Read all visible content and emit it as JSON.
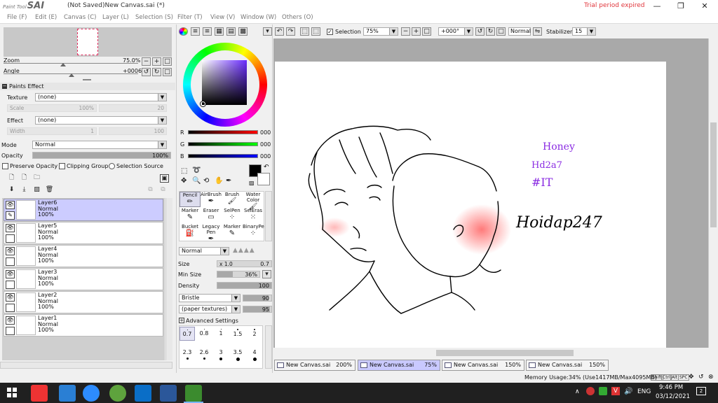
{
  "titlebar": {
    "logo_small": "Paint Tool",
    "logo_big": "SAI",
    "title": "(Not Saved)New Canvas.sai (*)",
    "trial_text": "Trial period expired",
    "min_glyph": "—",
    "max_glyph": "❐",
    "close_glyph": "✕"
  },
  "menu": [
    "File (F)",
    "Edit (E)",
    "Canvas (C)",
    "Layer (L)",
    "Selection (S)",
    "Filter (T)",
    "View (V)",
    "Window (W)",
    "Others (O)"
  ],
  "nav": {
    "zoom_label": "Zoom",
    "zoom_value": "75.0%",
    "angle_label": "Angle",
    "angle_value": "+0006"
  },
  "paints_effect": {
    "header": "Paints Effect",
    "texture_label": "Texture",
    "texture_value": "(none)",
    "scale_label": "Scale",
    "scale_value": "100%",
    "scale_right": "20",
    "effect_label": "Effect",
    "effect_value": "(none)",
    "width_label": "Width",
    "width_value": "1",
    "width_right": "100"
  },
  "layer_props": {
    "mode_label": "Mode",
    "mode_value": "Normal",
    "opacity_label": "Opacity",
    "opacity_value": "100%",
    "opacity_fraction": 1.0,
    "preserve_opacity": "Preserve Opacity",
    "clipping_group": "Clipping Group",
    "selection_source": "Selection Source"
  },
  "layers": [
    {
      "name": "Layer6",
      "mode": "Normal",
      "opacity": "100%",
      "selected": true,
      "visible": true
    },
    {
      "name": "Layer5",
      "mode": "Normal",
      "opacity": "100%",
      "selected": false,
      "visible": true
    },
    {
      "name": "Layer4",
      "mode": "Normal",
      "opacity": "100%",
      "selected": false,
      "visible": true
    },
    {
      "name": "Layer3",
      "mode": "Normal",
      "opacity": "100%",
      "selected": false,
      "visible": true
    },
    {
      "name": "Layer2",
      "mode": "Normal",
      "opacity": "100%",
      "selected": false,
      "visible": true
    },
    {
      "name": "Layer1",
      "mode": "Normal",
      "opacity": "100%",
      "selected": false,
      "visible": true
    }
  ],
  "color": {
    "r_label": "R",
    "r_value": "000",
    "g_label": "G",
    "g_value": "000",
    "b_label": "B",
    "b_value": "000",
    "primary": "#000000",
    "secondary": "#ffffff"
  },
  "tools": [
    {
      "label": "Pencil",
      "icon": "pencil-icon",
      "selected": true
    },
    {
      "label": "AirBrush",
      "icon": "airbrush-icon",
      "selected": false
    },
    {
      "label": "Brush",
      "icon": "brush-icon",
      "selected": false
    },
    {
      "label": "Water Color",
      "icon": "watercolor-icon",
      "selected": false
    },
    {
      "label": "Marker",
      "icon": "marker-icon",
      "selected": false
    },
    {
      "label": "Eraser",
      "icon": "eraser-icon",
      "selected": false
    },
    {
      "label": "SelPen",
      "icon": "selpen-icon",
      "selected": false
    },
    {
      "label": "SelEras",
      "icon": "seleras-icon",
      "selected": false
    },
    {
      "label": "Bucket",
      "icon": "bucket-icon",
      "selected": false
    },
    {
      "label": "Legacy Pen",
      "icon": "legacy-pen-icon",
      "selected": false
    },
    {
      "label": "Marker",
      "icon": "marker-icon",
      "selected": false
    },
    {
      "label": "BinaryPe",
      "icon": "binary-pen-icon",
      "selected": false
    }
  ],
  "brush": {
    "blend_mode": "Normal",
    "size_label": "Size",
    "size_mult": "x 1.0",
    "size_value": "0.7",
    "min_size_label": "Min Size",
    "min_size_value": "36%",
    "min_size_fraction": 0.36,
    "density_label": "Density",
    "density_value": "100",
    "density_fraction": 1.0,
    "bristle_label": "Bristle",
    "bristle_value": "90",
    "texture_label": "(paper textures)",
    "texture_value": "95",
    "advanced": "Advanced Settings",
    "sizes_row1": [
      "0.7",
      "0.8",
      "1",
      "1.5",
      "2"
    ],
    "sizes_row2": [
      "2.3",
      "2.6",
      "3",
      "3.5",
      "4"
    ]
  },
  "toolbar": {
    "selection_label": "Selection",
    "zoom_value": "75%",
    "angle_value": "+000°",
    "blend_value": "Normal",
    "stabilizer_label": "Stabilizer",
    "stabilizer_value": "15"
  },
  "artwork_text": {
    "line1": "Honey",
    "line2": "Hd2a7",
    "line3": "#IT",
    "signature": "Hoidap247"
  },
  "canvas_tabs": [
    {
      "name": "New Canvas.sai",
      "zoom": "200%",
      "selected": false
    },
    {
      "name": "New Canvas.sai",
      "zoom": "75%",
      "selected": true
    },
    {
      "name": "New Canvas.sai",
      "zoom": "150%",
      "selected": false
    },
    {
      "name": "New Canvas.sai",
      "zoom": "150%",
      "selected": false
    }
  ],
  "status": {
    "memory": "Memory Usage:34% (Use1417MB/Max4095MB)",
    "keys": [
      "Shift",
      "Ctrl",
      "Alt",
      "SPC"
    ]
  },
  "taskbar": {
    "lang": "ENG",
    "time": "9:46 PM",
    "date": "03/12/2021",
    "notif": "2"
  },
  "colors": {
    "selection_accent": "#ccccff",
    "trial_red": "#e0353b",
    "text_purple": "#8a2be2",
    "blush": "#ff6b6b"
  }
}
